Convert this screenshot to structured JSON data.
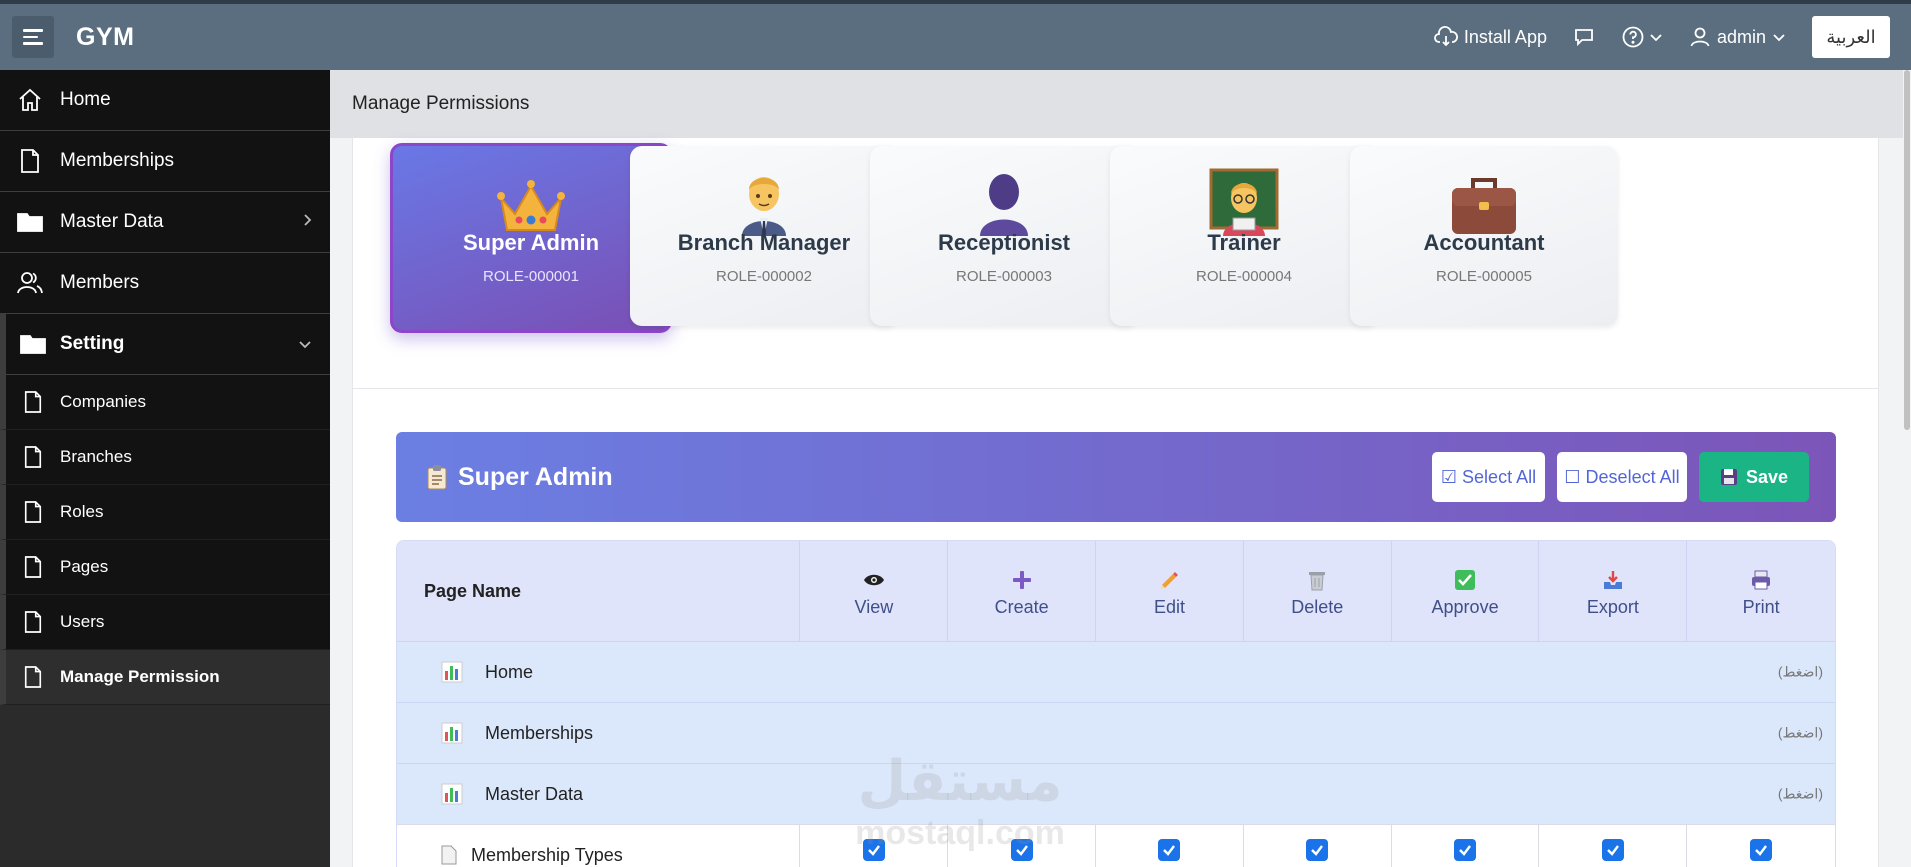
{
  "app": {
    "title": "GYM"
  },
  "topbar": {
    "install_label": "Install App",
    "user_label": "admin",
    "lang_label": "العربية"
  },
  "sidebar": {
    "items": [
      {
        "label": "Home",
        "icon": "home-icon"
      },
      {
        "label": "Memberships",
        "icon": "file-icon"
      },
      {
        "label": "Master Data",
        "icon": "folder-icon"
      },
      {
        "label": "Members",
        "icon": "users-icon"
      },
      {
        "label": "Setting",
        "icon": "folder-icon"
      }
    ],
    "sub_items": [
      {
        "label": "Companies",
        "icon": "file-icon"
      },
      {
        "label": "Branches",
        "icon": "file-icon"
      },
      {
        "label": "Roles",
        "icon": "file-icon"
      },
      {
        "label": "Pages",
        "icon": "file-icon"
      },
      {
        "label": "Users",
        "icon": "file-icon"
      },
      {
        "label": "Manage Permission",
        "icon": "file-icon"
      }
    ]
  },
  "page": {
    "title": "Manage Permissions"
  },
  "roles": [
    {
      "name": "Super Admin",
      "code": "ROLE-000001",
      "icon": "crown-icon"
    },
    {
      "name": "Branch Manager",
      "code": "ROLE-000002",
      "icon": "manager-icon"
    },
    {
      "name": "Receptionist",
      "code": "ROLE-000003",
      "icon": "person-silhouette-icon"
    },
    {
      "name": "Trainer",
      "code": "ROLE-000004",
      "icon": "teacher-icon"
    },
    {
      "name": "Accountant",
      "code": "ROLE-000005",
      "icon": "briefcase-icon"
    }
  ],
  "permissions": {
    "title": "Super Admin",
    "select_all_label": "☑ Select All",
    "deselect_all_label": "☐ Deselect All",
    "save_label": "Save",
    "columns": {
      "page_name": "Page Name",
      "view": "View",
      "create": "Create",
      "edit": "Edit",
      "delete": "Delete",
      "approve": "Approve",
      "export": "Export",
      "print": "Print"
    },
    "groups": [
      {
        "name": "Home",
        "hint": "(اضغط)"
      },
      {
        "name": "Memberships",
        "hint": "(اضغط)"
      },
      {
        "name": "Master Data",
        "hint": "(اضغط)"
      }
    ],
    "rows": [
      {
        "name": "Membership Types",
        "view": true,
        "create": true,
        "edit": true,
        "delete": true,
        "approve": true,
        "export": true,
        "print": true
      }
    ]
  },
  "watermark": {
    "line1": "مستقل",
    "line2": "mostaql.com"
  }
}
